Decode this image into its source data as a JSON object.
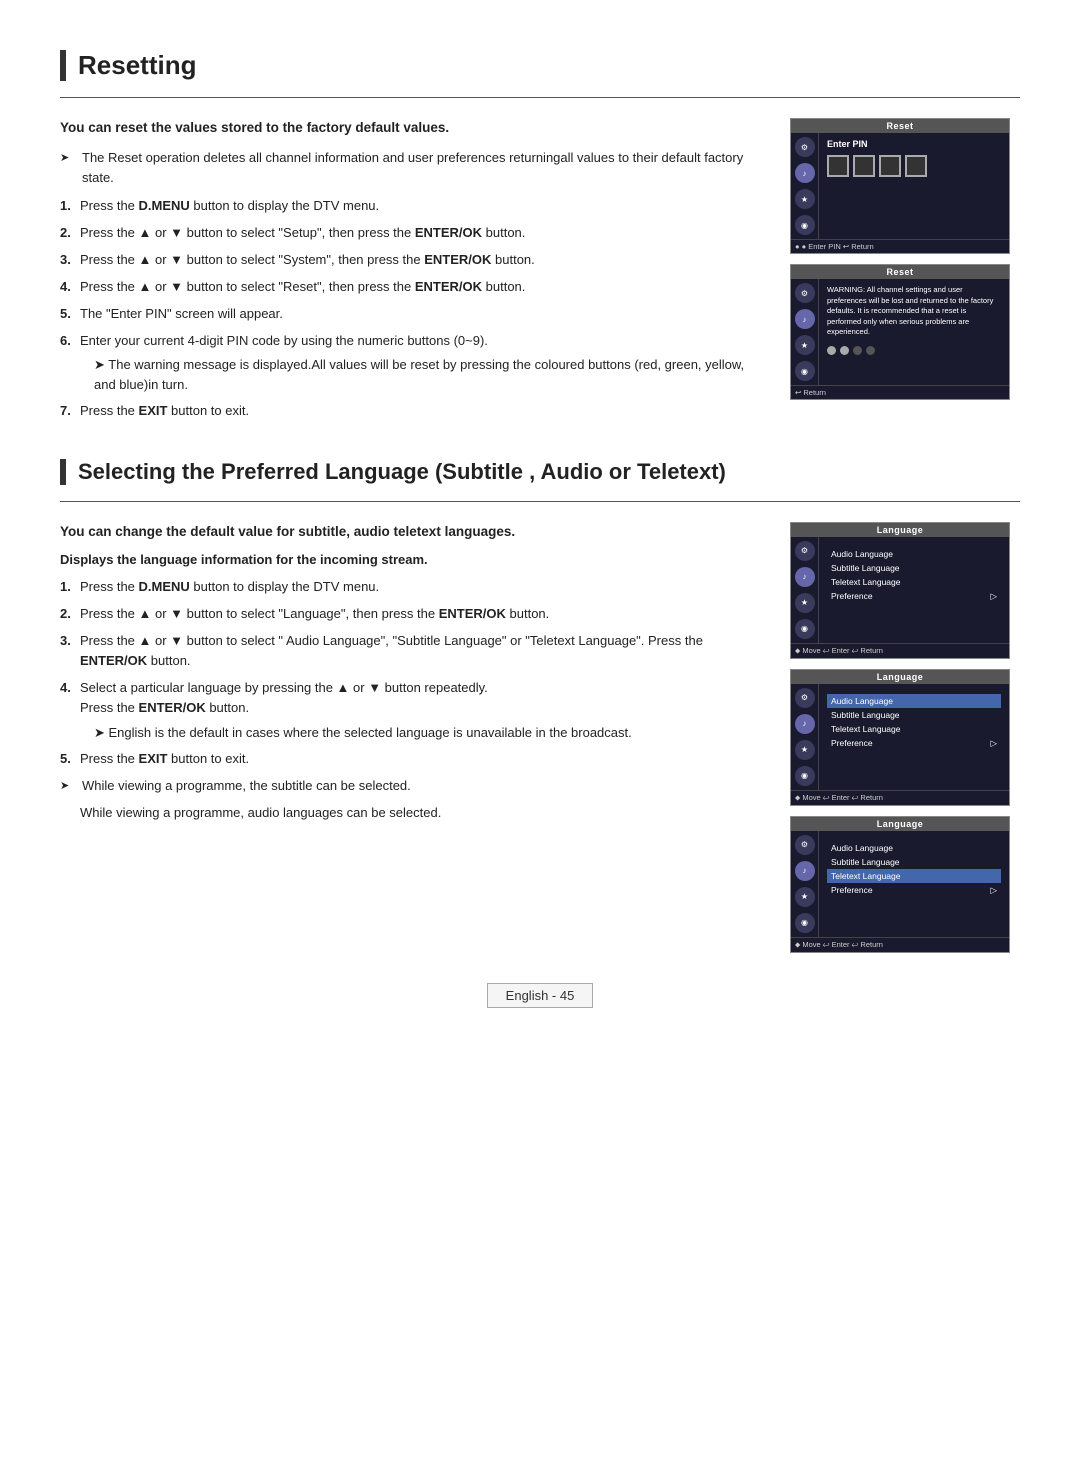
{
  "resetting": {
    "title": "Resetting",
    "intro": "You can reset the values stored to the factory default values.",
    "bullets": [
      "The Reset operation deletes all channel information and user preferences returningall values to their default factory state."
    ],
    "steps": [
      "Press the D.MENU button to display the DTV menu.",
      "Press the ▲ or ▼ button to select \"Setup\", then press the ENTER/OK button.",
      "Press the ▲ or ▼ button to select \"System\", then press the ENTER/OK button.",
      "Press the ▲ or ▼ button to select \"Reset\", then press the ENTER/OK button.",
      "The \"Enter PIN\" screen will appear.",
      "Enter your current 4-digit PIN code by using the numeric buttons (0~9).",
      "Press the EXIT button to exit."
    ],
    "step6_sub": "The warning message is displayed.All values will be reset by pressing the coloured buttons (red, green, yellow, and blue)in turn.",
    "screens": {
      "screen1": {
        "title": "Reset",
        "enterPIN": "Enter PIN",
        "footer": "● ● Enter PIN   ↩ Return"
      },
      "screen2": {
        "title": "Reset",
        "warning": "WARNING: All channel settings and user preferences will be lost and returned to the factory defaults. It is recommended that a reset is performed only when serious problems are experienced.",
        "footer": "↩ Return"
      }
    }
  },
  "language": {
    "title": "Selecting the Preferred Language (Subtitle , Audio or Teletext)",
    "intro": "You can change the default value for subtitle, audio teletext languages.",
    "displays_note": "Displays the language information for the incoming stream.",
    "steps": [
      "Press the D.MENU button to display the DTV menu.",
      "Press the ▲ or ▼ button to select \"Language\", then press the ENTER/OK button.",
      "Press the ▲ or ▼ button to select \" Audio Language\", \"Subtitle Language\" or \"Teletext Language\". Press the ENTER/OK button.",
      "Select a particular language by pressing the ▲ or ▼ button repeatedly.",
      "Press the EXIT button to exit."
    ],
    "step4_sub": "English is the default in cases where the selected language is unavailable in the broadcast.",
    "step4_press": "Press the ENTER/OK button.",
    "bullet1": "While viewing a programme, the subtitle can be selected.",
    "bullet1_sub": "While viewing a programme, audio languages can be selected.",
    "screens": {
      "title": "Language",
      "menu_items": [
        {
          "label": "Audio Language",
          "highlighted": false
        },
        {
          "label": "Subtitle Language",
          "highlighted": false
        },
        {
          "label": "Teletext Language",
          "highlighted": false
        },
        {
          "label": "Preference",
          "arrow": "▷",
          "highlighted": false
        }
      ],
      "footer": "⬥ Move   ↩ Enter   ↩ Return",
      "screen2_highlighted": "Audio Language",
      "screen3_highlighted": "Teletext Language"
    }
  },
  "footer": {
    "label": "English - 45"
  }
}
